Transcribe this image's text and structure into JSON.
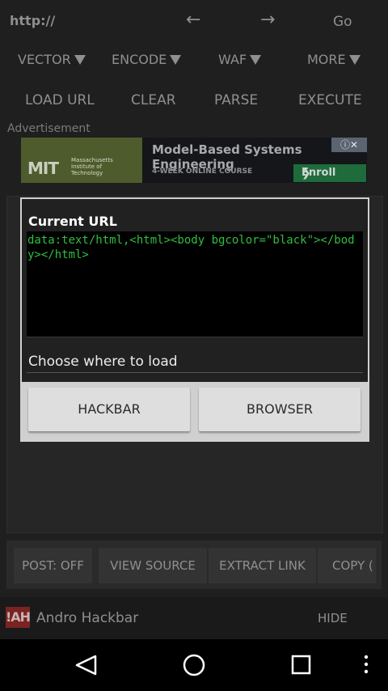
{
  "top": {
    "url_value": "http://",
    "back_label": "←",
    "forward_label": "→",
    "go_label": "Go"
  },
  "menus": [
    {
      "label": "VECTOR"
    },
    {
      "label": "ENCODE"
    },
    {
      "label": "WAF"
    },
    {
      "label": "MORE"
    }
  ],
  "actions": {
    "load_url": "LOAD URL",
    "clear": "CLEAR",
    "parse": "PARSE",
    "execute": "EXECUTE"
  },
  "ad": {
    "label": "Advertisement",
    "logo_text": "MIT",
    "institute_text": "Massachusetts\nInstitute of\nTechnology",
    "title": "Model-Based Systems Engineering",
    "subtitle": "4-WEEK ONLINE COURSE",
    "enroll_label": "Enroll",
    "badge": "ⓘ✕"
  },
  "dialog": {
    "title": "Current URL",
    "code": "data:text/html,<html><body bgcolor=\"black\"></body></html>",
    "prompt": "Choose where to load",
    "hackbar_label": "HACKBAR",
    "browser_label": "BROWSER"
  },
  "toolbar": {
    "post_label": "POST: OFF",
    "view_source": "VIEW SOURCE",
    "extract_link": "EXTRACT LINK",
    "copy_label": "COPY ("
  },
  "appbar": {
    "logo_text": "!AH",
    "name": "Andro Hackbar",
    "hide_label": "HIDE"
  },
  "icons": {
    "back": "back-triangle-icon",
    "home": "home-circle-icon",
    "recents": "recents-square-icon",
    "overflow": "overflow-menu-icon"
  }
}
